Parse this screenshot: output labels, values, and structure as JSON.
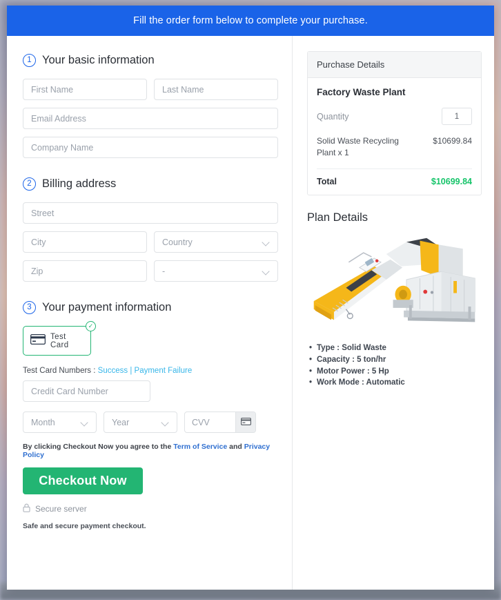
{
  "banner": {
    "text": "Fill the order form below to complete your purchase."
  },
  "steps": [
    {
      "number": "1",
      "title": "Your basic information"
    },
    {
      "number": "2",
      "title": "Billing address"
    },
    {
      "number": "3",
      "title": "Your payment information"
    }
  ],
  "basic_info": {
    "first_name": {
      "placeholder": "First Name",
      "value": ""
    },
    "last_name": {
      "placeholder": "Last Name",
      "value": ""
    },
    "email": {
      "placeholder": "Email Address",
      "value": ""
    },
    "company": {
      "placeholder": "Company Name",
      "value": ""
    }
  },
  "billing": {
    "street": {
      "placeholder": "Street",
      "value": ""
    },
    "city": {
      "placeholder": "City",
      "value": ""
    },
    "country": {
      "placeholder": "Country",
      "value": ""
    },
    "zip": {
      "placeholder": "Zip",
      "value": ""
    },
    "state": {
      "placeholder": "-",
      "value": "-"
    }
  },
  "payment": {
    "card_option_label": "Test Card",
    "card_option_selected": true,
    "test_cards_prefix": "Test Card Numbers :",
    "success_link": "Success",
    "separator": "|",
    "failure_link": "Payment Failure",
    "card_number": {
      "placeholder": "Credit Card Number",
      "value": ""
    },
    "month": {
      "placeholder": "Month",
      "value": ""
    },
    "year": {
      "placeholder": "Year",
      "value": ""
    },
    "cvv": {
      "placeholder": "CVV",
      "value": ""
    }
  },
  "terms": {
    "prefix": "By clicking Checkout Now you agree to the",
    "tos": "Term of Service",
    "and": "and",
    "privacy": "Privacy Policy"
  },
  "checkout": {
    "button_label": "Checkout Now",
    "secure_label": "Secure server",
    "safe_note": "Safe and secure payment checkout."
  },
  "purchase": {
    "header": "Purchase Details",
    "product_name": "Factory Waste Plant",
    "quantity_label": "Quantity",
    "quantity_value": "1",
    "line_item_name": "Solid Waste Recycling Plant x 1",
    "line_item_price": "$10699.84",
    "total_label": "Total",
    "total_value": "$10699.84"
  },
  "plan": {
    "title": "Plan Details",
    "specs": [
      "Type : Solid Waste",
      "Capacity : 5 ton/hr",
      "Motor Power : 5 Hp",
      "Work Mode : Automatic"
    ]
  },
  "colors": {
    "banner_blue": "#1a63e8",
    "accent_green": "#23b573",
    "total_green": "#16c46a",
    "link_blue": "#2f6fd0",
    "test_link_cyan": "#37b6e9"
  }
}
